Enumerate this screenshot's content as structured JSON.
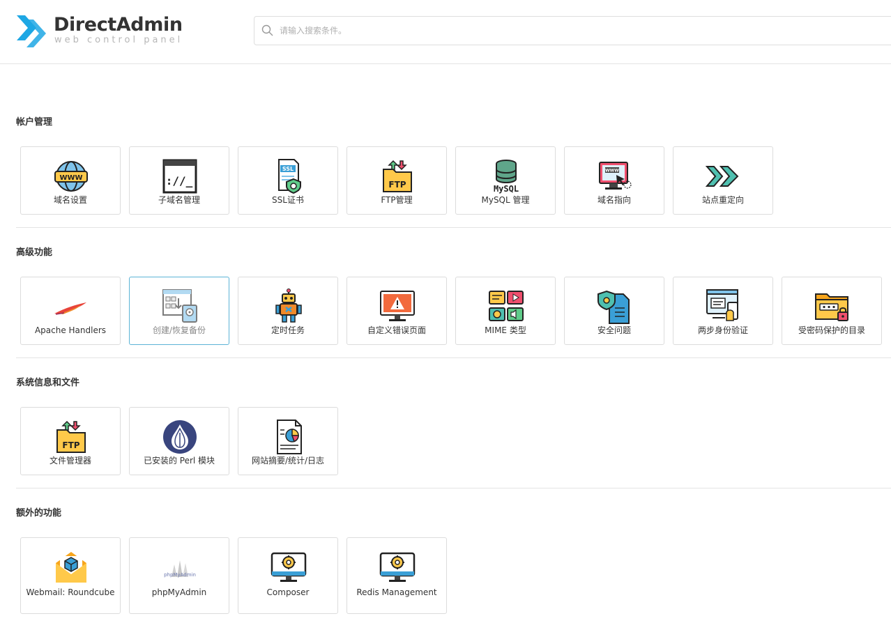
{
  "brand": {
    "title": "DirectAdmin",
    "subtitle": "web control panel"
  },
  "search": {
    "placeholder": "请输入搜索条件。"
  },
  "sections": [
    {
      "title": "帐户管理",
      "items": [
        {
          "label": "域名设置",
          "icon": "globe-www-icon"
        },
        {
          "label": "子域名管理",
          "icon": "subdomain-window-icon"
        },
        {
          "label": "SSL证书",
          "icon": "ssl-certificate-icon"
        },
        {
          "label": "FTP管理",
          "icon": "ftp-folder-icon"
        },
        {
          "label": "MySQL 管理",
          "icon": "mysql-database-icon"
        },
        {
          "label": "域名指向",
          "icon": "domain-pointer-icon"
        },
        {
          "label": "站点重定向",
          "icon": "site-redirect-icon"
        }
      ]
    },
    {
      "title": "高级功能",
      "items": [
        {
          "label": "Apache Handlers",
          "icon": "apache-feather-icon"
        },
        {
          "label": "创建/恢复备份",
          "icon": "backup-restore-icon"
        },
        {
          "label": "定时任务",
          "icon": "cron-robot-icon"
        },
        {
          "label": "自定义错误页面",
          "icon": "error-page-icon"
        },
        {
          "label": "MIME 类型",
          "icon": "mime-types-icon"
        },
        {
          "label": "安全问题",
          "icon": "security-questions-icon"
        },
        {
          "label": "两步身份验证",
          "icon": "two-step-auth-icon"
        },
        {
          "label": "受密码保护的目录",
          "icon": "password-folder-icon"
        }
      ]
    },
    {
      "title": "系统信息和文件",
      "items": [
        {
          "label": "文件管理器",
          "icon": "file-manager-icon"
        },
        {
          "label": "已安装的 Perl 模块",
          "icon": "perl-onion-icon"
        },
        {
          "label": "网站摘要/统计/日志",
          "icon": "site-stats-icon"
        }
      ]
    },
    {
      "title": "额外的功能",
      "items": [
        {
          "label": "Webmail: Roundcube",
          "icon": "webmail-envelope-icon"
        },
        {
          "label": "phpMyAdmin",
          "icon": "phpmyadmin-logo-icon",
          "logo_text": "phpMyAdmin"
        },
        {
          "label": "Composer",
          "icon": "composer-monitor-icon"
        },
        {
          "label": "Redis Management",
          "icon": "redis-monitor-icon"
        }
      ]
    }
  ],
  "colors": {
    "brand_blue": "#1ea7e4",
    "active_border": "#5bb3d6",
    "divider": "#e4e4e4"
  }
}
